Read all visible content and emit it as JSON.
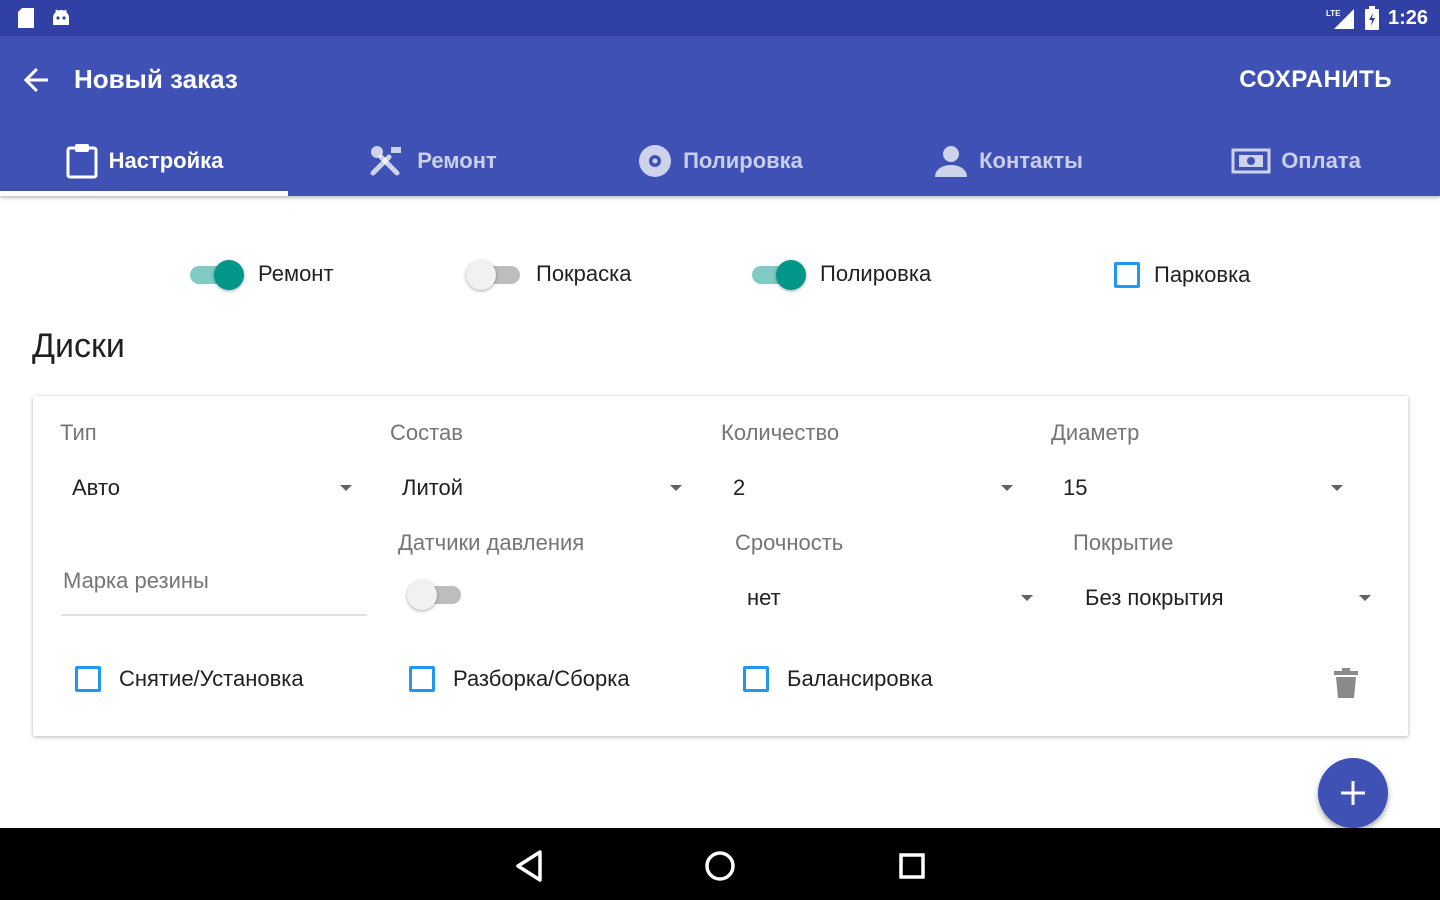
{
  "status_bar": {
    "time": "1:26",
    "network": "LTE"
  },
  "app_bar": {
    "title": "Новый заказ",
    "save_label": "СОХРАНИТЬ"
  },
  "tabs": [
    {
      "label": "Настройка",
      "icon": "clipboard-icon",
      "active": true
    },
    {
      "label": "Ремонт",
      "icon": "tools-icon",
      "active": false
    },
    {
      "label": "Полировка",
      "icon": "disc-icon",
      "active": false
    },
    {
      "label": "Контакты",
      "icon": "person-icon",
      "active": false
    },
    {
      "label": "Оплата",
      "icon": "money-icon",
      "active": false
    }
  ],
  "options": {
    "repair": {
      "label": "Ремонт",
      "on": true
    },
    "painting": {
      "label": "Покраска",
      "on": false
    },
    "polishing": {
      "label": "Полировка",
      "on": true
    },
    "parking": {
      "label": "Парковка",
      "checked": false
    }
  },
  "section": {
    "title": "Диски"
  },
  "disk_card": {
    "type": {
      "label": "Тип",
      "value": "Авто"
    },
    "composition": {
      "label": "Состав",
      "value": "Литой"
    },
    "quantity": {
      "label": "Количество",
      "value": "2"
    },
    "diameter": {
      "label": "Диаметр",
      "value": "15"
    },
    "tire_brand": {
      "placeholder": "Марка резины"
    },
    "pressure_sensors": {
      "label": "Датчики давления",
      "on": false
    },
    "urgency": {
      "label": "Срочность",
      "value": "нет"
    },
    "coating": {
      "label": "Покрытие",
      "value": "Без покрытия"
    },
    "checks": [
      {
        "label": "Снятие/Установка",
        "checked": false
      },
      {
        "label": "Разборка/Сборка",
        "checked": false
      },
      {
        "label": "Балансировка",
        "checked": false
      }
    ]
  },
  "colors": {
    "primary": "#3f51b5",
    "status_bar": "#3140a4",
    "accent": "#009688",
    "checkbox": "#2196f3"
  }
}
